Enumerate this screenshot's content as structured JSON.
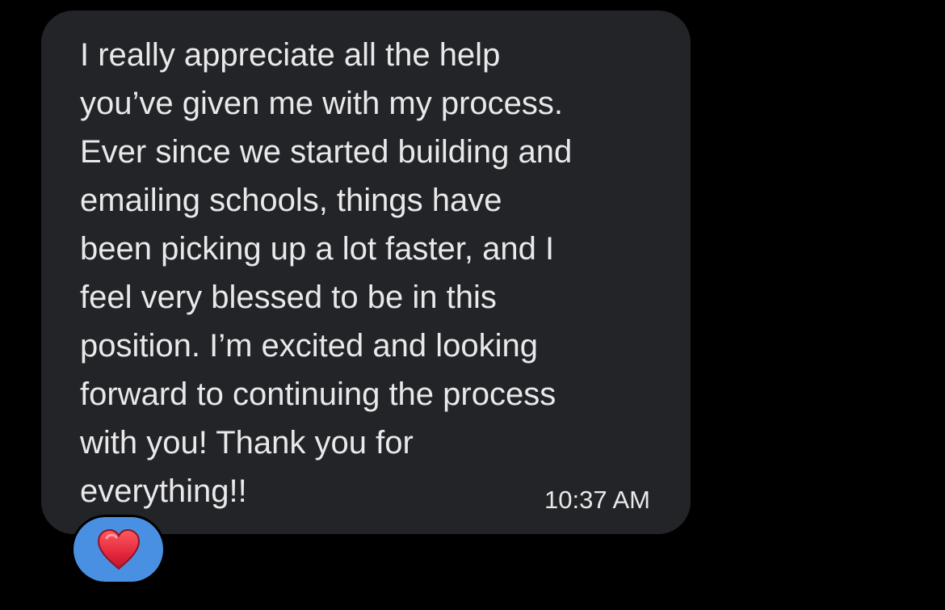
{
  "message": {
    "lines": [
      "I really appreciate all the help",
      "you’ve given me with my process.",
      "Ever since we started building and",
      "emailing schools, things have",
      "been picking up a lot faster, and I",
      "feel very blessed to be in this",
      "position. I’m excited and looking",
      "forward to continuing the process",
      "with you! Thank you for",
      "everything!!"
    ],
    "timestamp": "10:37 AM"
  },
  "reaction": {
    "icon": "heart-icon",
    "color": "#e0243a",
    "badge_color": "#4a90e2"
  },
  "colors": {
    "background": "#000000",
    "bubble": "#232427",
    "text": "#e9e9eb"
  }
}
